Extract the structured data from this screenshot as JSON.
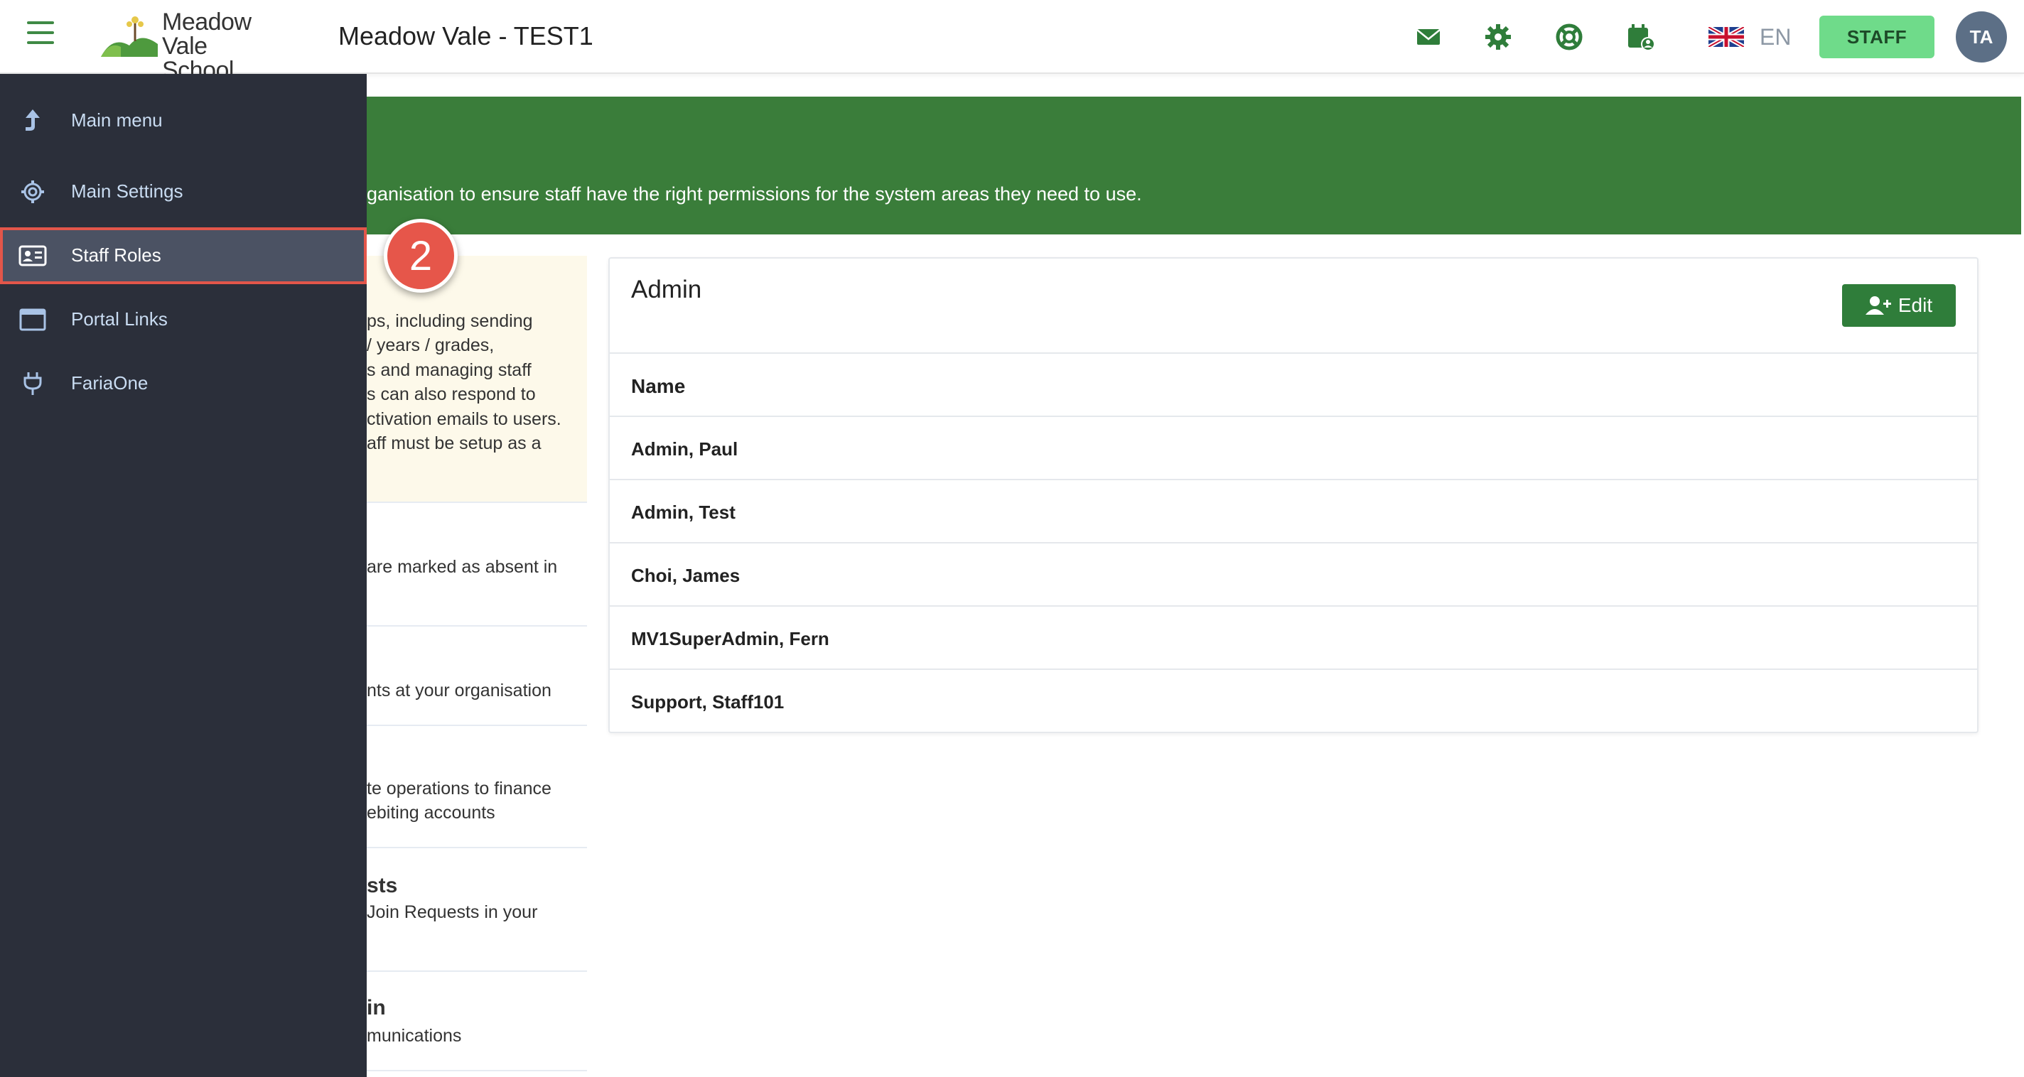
{
  "header": {
    "logo_line1": "Meadow",
    "logo_line2": "Vale School",
    "title": "Meadow Vale - TEST1",
    "icons": [
      "envelope-icon",
      "gear-icon",
      "lifebuoy-icon",
      "calendar-user-icon"
    ],
    "language": "EN",
    "role_button": "STAFF",
    "avatar_initials": "TA"
  },
  "sidebar": {
    "items": [
      {
        "label": "Main menu",
        "icon": "arrow-up-icon"
      },
      {
        "label": "Main Settings",
        "icon": "settings-cog-icon"
      },
      {
        "label": "Staff Roles",
        "icon": "id-card-icon",
        "active": true
      },
      {
        "label": "Portal Links",
        "icon": "browser-window-icon"
      },
      {
        "label": "FariaOne",
        "icon": "plug-icon"
      }
    ]
  },
  "step_badge": "2",
  "banner": {
    "text": "ganisation to ensure staff have the right permissions for the system areas they need to use."
  },
  "left_cards": {
    "card1_lines": [
      "ps, including sending",
      "/ years / grades,",
      "s and managing staff",
      "s can also respond to",
      "ctivation emails to users.",
      "aff must be setup as a"
    ],
    "card2_lines": [
      "are marked as absent in"
    ],
    "card3_lines": [
      "nts at your organisation"
    ],
    "card4_lines": [
      "te operations to finance",
      "ebiting accounts"
    ],
    "card5_head": "sts",
    "card5_lines": [
      "Join Requests in your"
    ],
    "card6_head": "in",
    "card6_lines": [
      "munications"
    ]
  },
  "panel": {
    "title": "Admin",
    "edit_label": "Edit",
    "column_header": "Name",
    "rows": [
      "Admin, Paul",
      "Admin, Test",
      "Choi, James",
      "MV1SuperAdmin, Fern",
      "Support, Staff101"
    ]
  },
  "colors": {
    "brand_green": "#3a7d3a",
    "staff_button": "#6fdb8a",
    "sidebar_bg": "#2b2f3a",
    "highlight": "#e3564a"
  }
}
